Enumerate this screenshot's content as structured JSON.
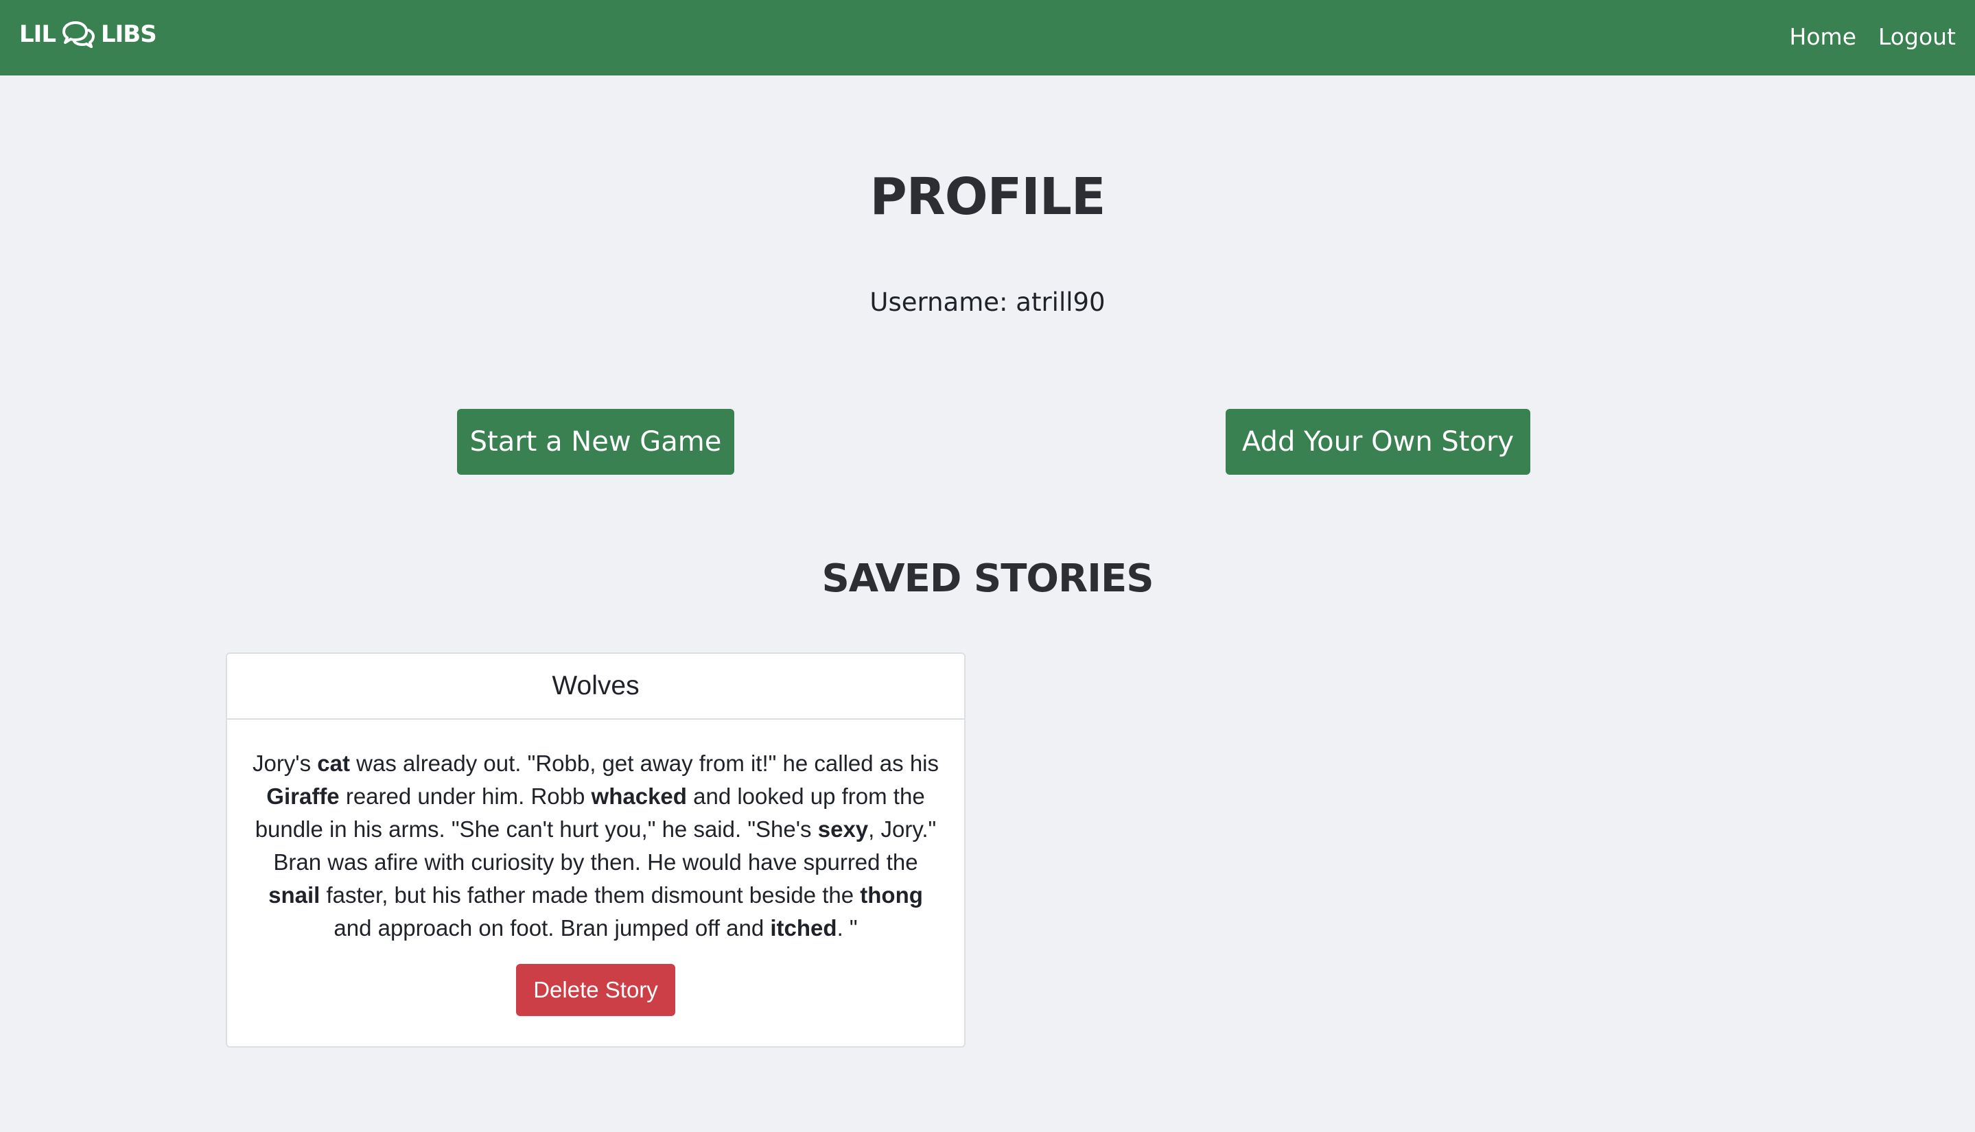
{
  "navbar": {
    "brand_left": "LIL",
    "brand_right": "LIBS",
    "brand_icon": "chat-bubbles-icon",
    "links": [
      {
        "label": "Home"
      },
      {
        "label": "Logout"
      }
    ],
    "background_color": "#3a8152"
  },
  "profile": {
    "title": "Profile",
    "username_label": "Username:",
    "username_value": "atrill90"
  },
  "actions": {
    "new_game_label": "Start a New Game",
    "add_story_label": "Add Your Own Story"
  },
  "saved_stories": {
    "title": "Saved Stories",
    "stories": [
      {
        "title": "Wolves",
        "segments": [
          {
            "text": "Jory's ",
            "bold": false
          },
          {
            "text": "cat",
            "bold": true
          },
          {
            "text": " was already out. \"Robb, get away from it!\" he called as his ",
            "bold": false
          },
          {
            "text": "Giraffe",
            "bold": true
          },
          {
            "text": " reared under him. Robb ",
            "bold": false
          },
          {
            "text": "whacked",
            "bold": true
          },
          {
            "text": " and looked up from the bundle in his arms. \"She can't hurt you,\" he said. \"She's ",
            "bold": false
          },
          {
            "text": "sexy",
            "bold": true
          },
          {
            "text": ", Jory.\" Bran was afire with curiosity by then. He would have spurred the ",
            "bold": false
          },
          {
            "text": "snail",
            "bold": true
          },
          {
            "text": " faster, but his father made them dismount beside the ",
            "bold": false
          },
          {
            "text": "thong",
            "bold": true
          },
          {
            "text": " and approach on foot. Bran jumped off and ",
            "bold": false
          },
          {
            "text": "itched",
            "bold": true
          },
          {
            "text": ". \"",
            "bold": false
          }
        ],
        "delete_label": "Delete Story"
      }
    ]
  },
  "colors": {
    "page_background": "#f0f1f4",
    "primary_green": "#3a8152",
    "danger_red": "#cc3f47"
  }
}
